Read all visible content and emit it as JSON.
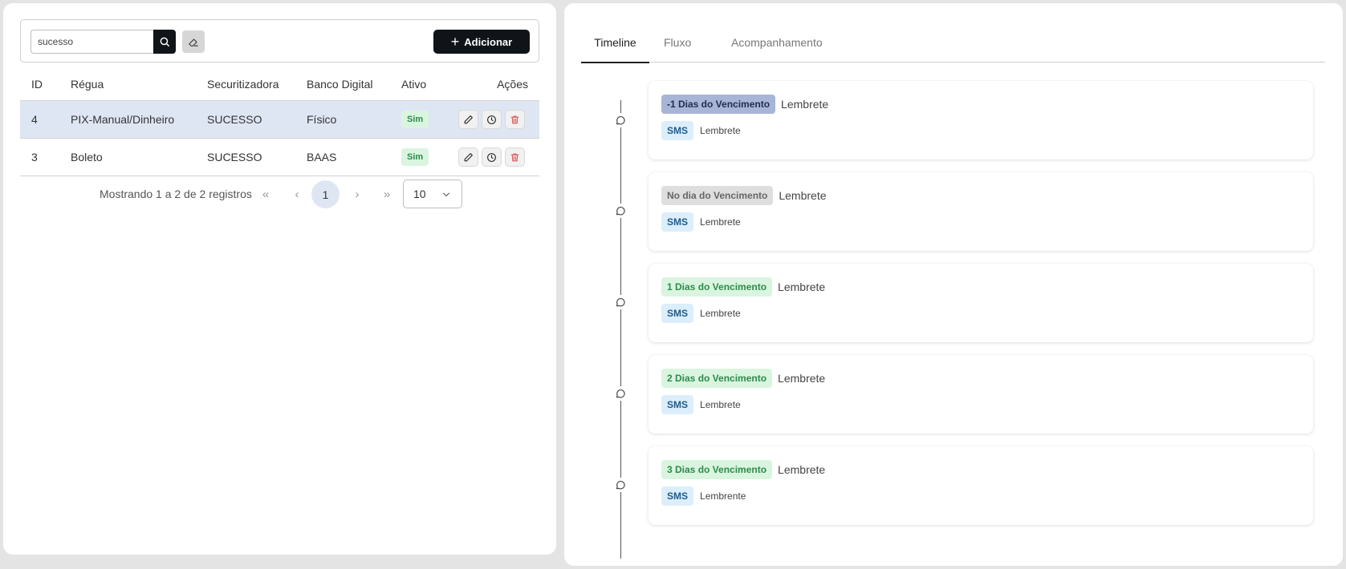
{
  "toolbar": {
    "search_value": "sucesso",
    "add_label": "Adicionar"
  },
  "table": {
    "headers": {
      "id": "ID",
      "regua": "Régua",
      "securitizadora": "Securitizadora",
      "banco": "Banco Digital",
      "ativo": "Ativo",
      "acoes": "Ações"
    },
    "rows": [
      {
        "id": "4",
        "regua": "PIX-Manual/Dinheiro",
        "securitizadora": "SUCESSO",
        "banco": "Físico",
        "ativo": "Sim",
        "selected": true
      },
      {
        "id": "3",
        "regua": "Boleto",
        "securitizadora": "SUCESSO",
        "banco": "BAAS",
        "ativo": "Sim",
        "selected": false
      }
    ]
  },
  "pagination": {
    "info": "Mostrando 1 a 2 de 2 registros",
    "first": "«",
    "prev": "‹",
    "current_page": "1",
    "next": "›",
    "last": "»",
    "page_size": "10"
  },
  "tabs": [
    {
      "label": "Timeline",
      "active": true
    },
    {
      "label": "Fluxo",
      "active": false
    },
    {
      "label": "Acompanhamento",
      "active": false
    }
  ],
  "timeline": [
    {
      "tag": "-1 Dias do Vencimento",
      "tag_style": "blue",
      "title": "Lembrete",
      "channel": "SMS",
      "description": "Lembrete"
    },
    {
      "tag": "No dia do Vencimento",
      "tag_style": "gray",
      "title": "Lembrete",
      "channel": "SMS",
      "description": "Lembrete"
    },
    {
      "tag": "1 Dias do Vencimento",
      "tag_style": "green",
      "title": "Lembrete",
      "channel": "SMS",
      "description": "Lembrete"
    },
    {
      "tag": "2 Dias do Vencimento",
      "tag_style": "green",
      "title": "Lembrete",
      "channel": "SMS",
      "description": "Lembrete"
    },
    {
      "tag": "3 Dias do Vencimento",
      "tag_style": "green",
      "title": "Lembrete",
      "channel": "SMS",
      "description": "Lembrente"
    }
  ],
  "colors": {
    "primary": "#101418",
    "selected_row": "#dfe6f3",
    "badge_green_bg": "#d9f5df",
    "badge_green_text": "#2e8b4b",
    "delete": "#d9534f"
  },
  "icons": {
    "search": "search-icon",
    "clear": "eraser-icon",
    "add": "plus-icon",
    "edit": "pencil-icon",
    "history": "clock-icon",
    "delete": "trash-icon",
    "timeline_event": "message-circle-icon"
  }
}
